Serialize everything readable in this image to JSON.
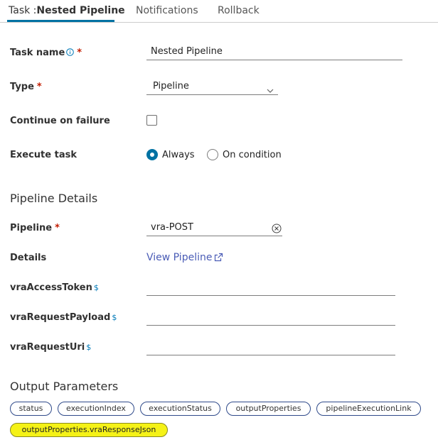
{
  "tabs": {
    "task_prefix": "Task :",
    "task_name": "Nested Pipeline",
    "notifications": "Notifications",
    "rollback": "Rollback"
  },
  "form": {
    "task_name_label": "Task name",
    "task_name_value": "Nested Pipeline",
    "type_label": "Type",
    "type_value": "Pipeline",
    "continue_label": "Continue on failure",
    "continue_checked": false,
    "execute_label": "Execute task",
    "execute_options": [
      "Always",
      "On condition"
    ],
    "execute_selected": "Always",
    "required_mark": "*"
  },
  "pipeline_details": {
    "title": "Pipeline Details",
    "pipeline_label": "Pipeline",
    "pipeline_value": "vra-POST",
    "details_label": "Details",
    "view_pipeline_link": "View Pipeline",
    "inputs": [
      {
        "label": "vraAccessToken",
        "marker": "$",
        "value": ""
      },
      {
        "label": "vraRequestPayload",
        "marker": "$",
        "value": ""
      },
      {
        "label": "vraRequestUri",
        "marker": "$",
        "value": ""
      }
    ]
  },
  "output_parameters": {
    "title": "Output Parameters",
    "items": [
      "status",
      "executionIndex",
      "executionStatus",
      "outputProperties",
      "pipelineExecutionLink",
      "outputProperties.vraResponseJson"
    ],
    "highlighted": "outputProperties.vraResponseJson"
  },
  "colors": {
    "accent": "#0072a3",
    "link": "#4a5cb6",
    "required": "#c21d00",
    "highlight": "#f5f217"
  }
}
